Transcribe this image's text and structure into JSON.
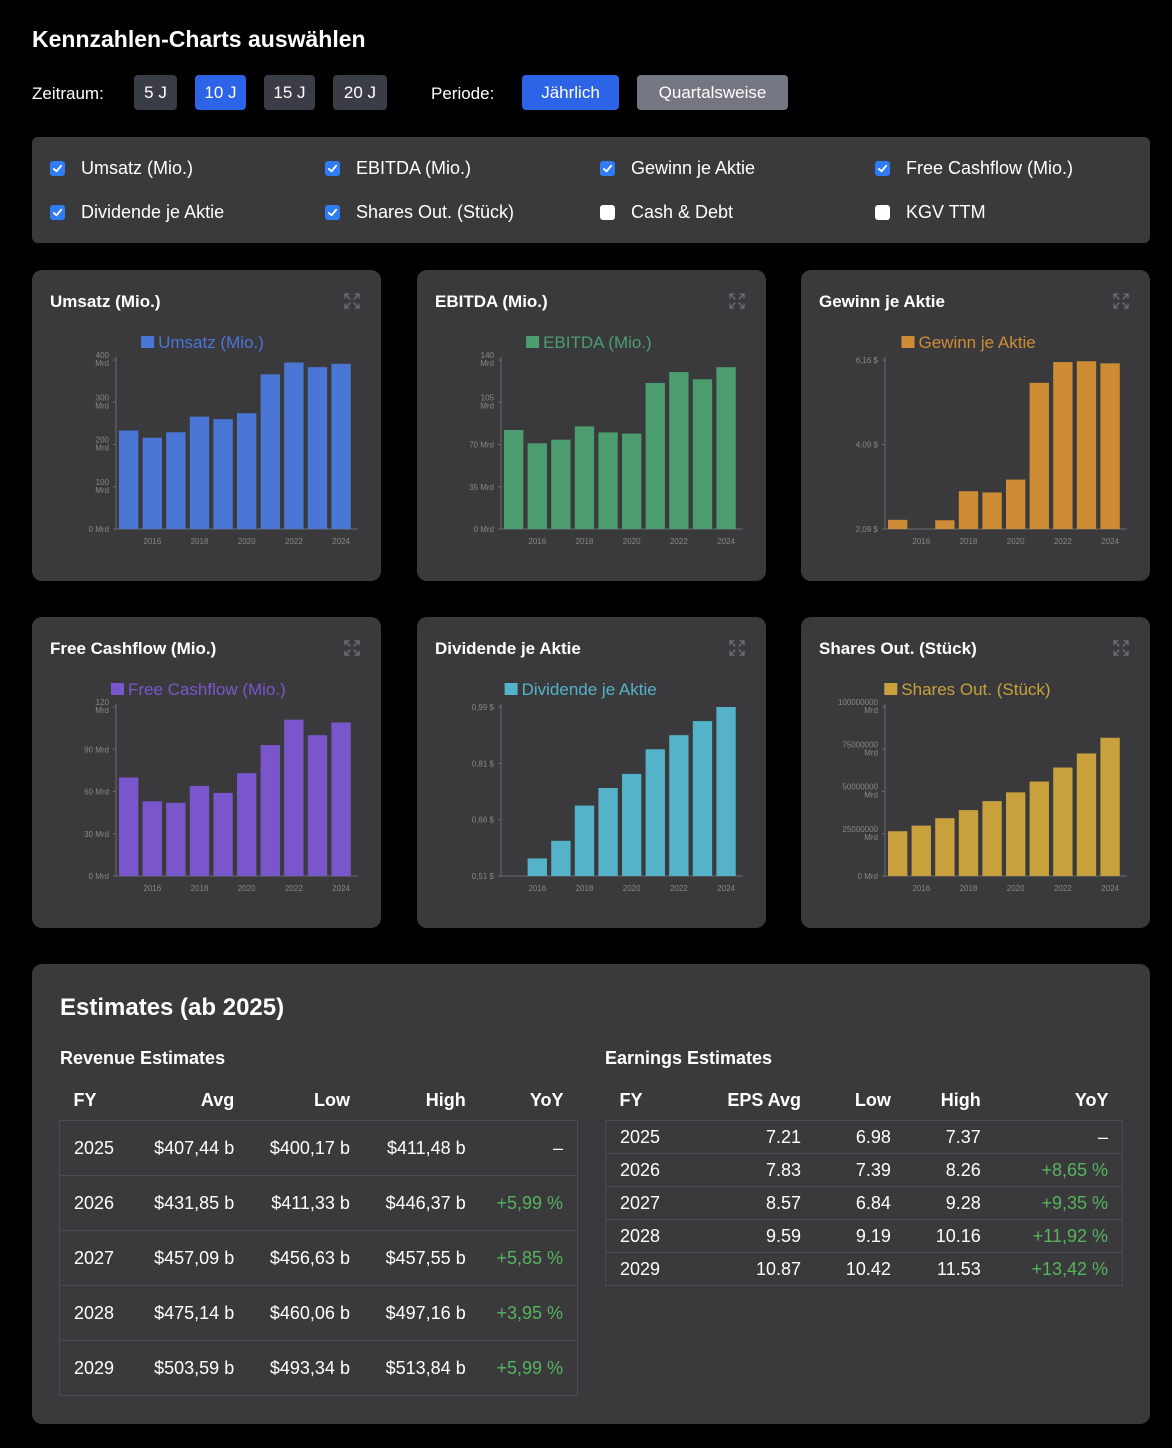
{
  "page_title": "Kennzahlen-Charts auswählen",
  "controls": {
    "zeitraum_label": "Zeitraum:",
    "zeitraum_buttons": [
      "5 J",
      "10 J",
      "15 J",
      "20 J"
    ],
    "zeitraum_active": "10 J",
    "periode_label": "Periode:",
    "periode_buttons": [
      "Jährlich",
      "Quartalsweise"
    ],
    "periode_active": "Jährlich"
  },
  "filters": [
    {
      "label": "Umsatz (Mio.)",
      "checked": true
    },
    {
      "label": "EBITDA (Mio.)",
      "checked": true
    },
    {
      "label": "Gewinn je Aktie",
      "checked": true
    },
    {
      "label": "Free Cashflow (Mio.)",
      "checked": true
    },
    {
      "label": "Dividende je Aktie",
      "checked": true
    },
    {
      "label": "Shares Out. (Stück)",
      "checked": true
    },
    {
      "label": "Cash & Debt",
      "checked": false
    },
    {
      "label": "KGV TTM",
      "checked": false
    }
  ],
  "charts": [
    {
      "title": "Umsatz (Mio.)",
      "legend": "Umsatz (Mio.)",
      "color": "#4a76d6",
      "y_ticks": [
        "0 Mrd",
        "100 Mrd",
        "200 Mrd",
        "300 Mrd",
        "400 Mrd"
      ]
    },
    {
      "title": "EBITDA (Mio.)",
      "legend": "EBITDA (Mio.)",
      "color": "#4c9e70",
      "y_ticks": [
        "0 Mrd",
        "35 Mrd",
        "70 Mrd",
        "105 Mrd",
        "140 Mrd"
      ]
    },
    {
      "title": "Gewinn je Aktie",
      "legend": "Gewinn je Aktie",
      "color": "#cf8c37",
      "y_ticks": [
        "2,09 $",
        "4,09 $",
        "6,16 $"
      ]
    },
    {
      "title": "Free Cashflow (Mio.)",
      "legend": "Free Cashflow (Mio.)",
      "color": "#7a56cc",
      "y_ticks": [
        "0 Mrd",
        "30 Mrd",
        "60 Mrd",
        "90 Mrd",
        "120 Mrd"
      ]
    },
    {
      "title": "Dividende je Aktie",
      "legend": "Dividende je Aktie",
      "color": "#54b2c9",
      "y_ticks": [
        "0,51 $",
        "0,66 $",
        "0,81 $",
        "0,99 $"
      ]
    },
    {
      "title": "Shares Out. (Stück)",
      "legend": "Shares Out. (Stück)",
      "color": "#c9a13c",
      "y_ticks": [
        "0 Mrd",
        "25000000 Mrd",
        "50000000 Mrd",
        "75000000 Mrd",
        "100000000 Mrd"
      ]
    }
  ],
  "chart_data": [
    {
      "type": "bar",
      "title": "Umsatz (Mio.)",
      "series": [
        {
          "name": "Umsatz (Mio.)",
          "values": [
            233,
            216,
            229,
            266,
            260,
            274,
            366,
            394,
            383,
            391
          ]
        }
      ],
      "x": [
        2015,
        2016,
        2017,
        2018,
        2019,
        2020,
        2021,
        2022,
        2023,
        2024
      ],
      "x_ticks": [
        "2016",
        "2018",
        "2020",
        "2022",
        "2024"
      ],
      "ylim": [
        0,
        400
      ],
      "unit": "Mrd"
    },
    {
      "type": "bar",
      "title": "EBITDA (Mio.)",
      "series": [
        {
          "name": "EBITDA (Mio.)",
          "values": [
            82,
            71,
            74,
            85,
            80,
            79,
            121,
            130,
            124,
            134
          ]
        }
      ],
      "x": [
        2015,
        2016,
        2017,
        2018,
        2019,
        2020,
        2021,
        2022,
        2023,
        2024
      ],
      "x_ticks": [
        "2016",
        "2018",
        "2020",
        "2022",
        "2024"
      ],
      "ylim": [
        0,
        140
      ],
      "unit": "Mrd"
    },
    {
      "type": "bar",
      "title": "Gewinn je Aktie",
      "series": [
        {
          "name": "Gewinn je Aktie",
          "values": [
            2.31,
            2.08,
            2.3,
            3.0,
            2.97,
            3.28,
            5.61,
            6.11,
            6.13,
            6.08
          ]
        }
      ],
      "x": [
        2015,
        2016,
        2017,
        2018,
        2019,
        2020,
        2021,
        2022,
        2023,
        2024
      ],
      "x_ticks": [
        "2016",
        "2018",
        "2020",
        "2022",
        "2024"
      ],
      "ylim": [
        2.09,
        6.16
      ],
      "unit": "$"
    },
    {
      "type": "bar",
      "title": "Free Cashflow (Mio.)",
      "series": [
        {
          "name": "Free Cashflow (Mio.)",
          "values": [
            70,
            53,
            52,
            64,
            59,
            73,
            93,
            111,
            100,
            109
          ]
        }
      ],
      "x": [
        2015,
        2016,
        2017,
        2018,
        2019,
        2020,
        2021,
        2022,
        2023,
        2024
      ],
      "x_ticks": [
        "2016",
        "2018",
        "2020",
        "2022",
        "2024"
      ],
      "ylim": [
        0,
        120
      ],
      "unit": "Mrd"
    },
    {
      "type": "bar",
      "title": "Dividende je Aktie",
      "series": [
        {
          "name": "Dividende je Aktie",
          "values": [
            0.51,
            0.56,
            0.61,
            0.71,
            0.76,
            0.8,
            0.87,
            0.91,
            0.95,
            0.99
          ]
        }
      ],
      "x": [
        2015,
        2016,
        2017,
        2018,
        2019,
        2020,
        2021,
        2022,
        2023,
        2024
      ],
      "x_ticks": [
        "2016",
        "2018",
        "2020",
        "2022",
        "2024"
      ],
      "ylim": [
        0.51,
        0.99
      ],
      "unit": "$"
    },
    {
      "type": "bar",
      "title": "Shares Out. (Stück)",
      "series": [
        {
          "name": "Shares Out. (Stück)",
          "values": [
            26500000,
            29800000,
            34200000,
            39000000,
            44300000,
            49500000,
            55900000,
            64200000,
            72500000,
            81800000
          ]
        }
      ],
      "x": [
        2015,
        2016,
        2017,
        2018,
        2019,
        2020,
        2021,
        2022,
        2023,
        2024
      ],
      "x_ticks": [
        "2016",
        "2018",
        "2020",
        "2022",
        "2024"
      ],
      "ylim": [
        0,
        100000000
      ],
      "unit": "Mrd"
    }
  ],
  "estimates": {
    "title": "Estimates (ab 2025)",
    "revenue": {
      "title": "Revenue Estimates",
      "headers": [
        "FY",
        "Avg",
        "Low",
        "High",
        "YoY"
      ],
      "rows": [
        [
          "2025",
          "$407,44 b",
          "$400,17 b",
          "$411,48 b",
          "–"
        ],
        [
          "2026",
          "$431,85 b",
          "$411,33 b",
          "$446,37 b",
          "+5,99 %"
        ],
        [
          "2027",
          "$457,09 b",
          "$456,63 b",
          "$457,55 b",
          "+5,85 %"
        ],
        [
          "2028",
          "$475,14 b",
          "$460,06 b",
          "$497,16 b",
          "+3,95 %"
        ],
        [
          "2029",
          "$503,59 b",
          "$493,34 b",
          "$513,84 b",
          "+5,99 %"
        ]
      ]
    },
    "earnings": {
      "title": "Earnings Estimates",
      "headers": [
        "FY",
        "EPS Avg",
        "Low",
        "High",
        "YoY"
      ],
      "rows": [
        [
          "2025",
          "7.21",
          "6.98",
          "7.37",
          "–"
        ],
        [
          "2026",
          "7.83",
          "7.39",
          "8.26",
          "+8,65 %"
        ],
        [
          "2027",
          "8.57",
          "6.84",
          "9.28",
          "+9,35 %"
        ],
        [
          "2028",
          "9.59",
          "9.19",
          "10.16",
          "+11,92 %"
        ],
        [
          "2029",
          "10.87",
          "10.42",
          "11.53",
          "+13,42 %"
        ]
      ]
    }
  }
}
